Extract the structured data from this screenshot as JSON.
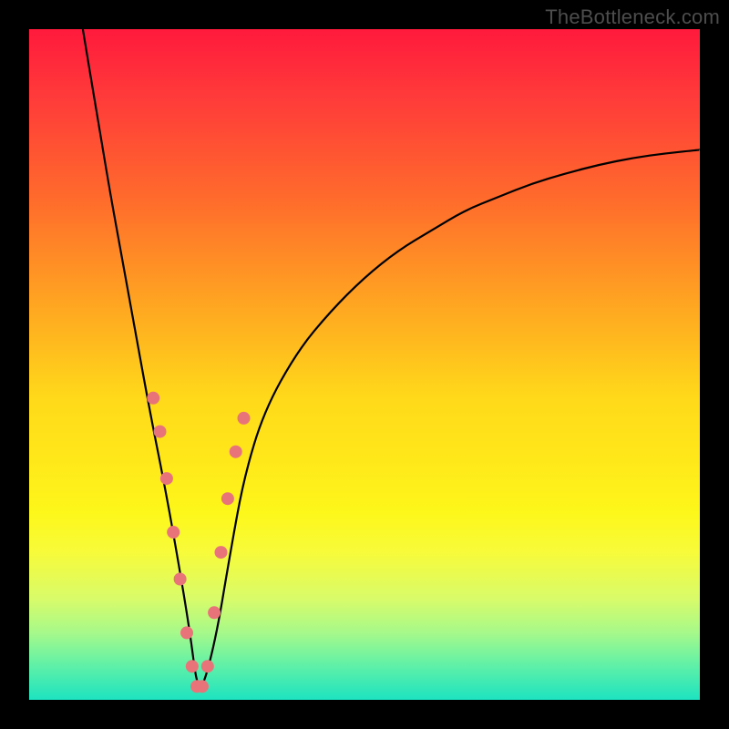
{
  "watermark": "TheBottleneck.com",
  "chart_data": {
    "type": "line",
    "title": "",
    "xlabel": "",
    "ylabel": "",
    "xlim": [
      0,
      100
    ],
    "ylim": [
      0,
      100
    ],
    "grid": false,
    "legend": false,
    "background_gradient": {
      "orientation": "vertical",
      "stops": [
        "#ff1a3c",
        "#ff8f25",
        "#ffe91a",
        "#5ef0a8",
        "#1de3c0"
      ]
    },
    "series": [
      {
        "name": "bottleneck-curve",
        "description": "V-shaped absolute-deviation style curve, minimum near x≈25, left branch starts near (8,100), right branch ends near (100,82)",
        "x": [
          8,
          10,
          12,
          14,
          16,
          18,
          20,
          22,
          24,
          25,
          26,
          28,
          30,
          32,
          35,
          40,
          45,
          50,
          55,
          60,
          65,
          70,
          75,
          80,
          85,
          90,
          95,
          100
        ],
        "y": [
          100,
          88,
          76,
          65,
          54,
          43,
          33,
          22,
          10,
          2,
          2,
          10,
          22,
          33,
          43,
          52,
          58,
          63,
          67,
          70,
          73,
          75,
          77,
          78.5,
          79.8,
          80.8,
          81.5,
          82
        ]
      }
    ],
    "markers": {
      "name": "highlighted-points",
      "color": "#e8747a",
      "radius_px": 7,
      "points_xy": [
        [
          18.5,
          45
        ],
        [
          19.5,
          40
        ],
        [
          20.5,
          33
        ],
        [
          21.5,
          25
        ],
        [
          22.5,
          18
        ],
        [
          23.5,
          10
        ],
        [
          24.3,
          5
        ],
        [
          25.0,
          2
        ],
        [
          25.8,
          2
        ],
        [
          26.6,
          5
        ],
        [
          27.6,
          13
        ],
        [
          28.6,
          22
        ],
        [
          29.6,
          30
        ],
        [
          30.8,
          37
        ],
        [
          32.0,
          42
        ]
      ]
    }
  }
}
